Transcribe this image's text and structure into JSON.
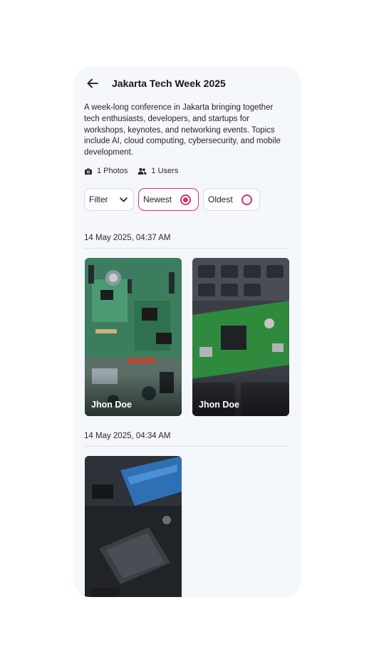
{
  "header": {
    "title": "Jakarta Tech Week 2025"
  },
  "event": {
    "description": "A week-long conference in Jakarta bringing together tech enthusiasts, developers, and startups for workshops, keynotes, and networking events. Topics include AI, cloud computing, cybersecurity, and mobile development."
  },
  "stats": {
    "photos": "1 Photos",
    "users": "1 Users"
  },
  "controls": {
    "filter_label": "Filter",
    "newest_label": "Newest",
    "oldest_label": "Oldest",
    "selected_sort": "Newest"
  },
  "groups": [
    {
      "date": "14 May 2025, 04:37 AM",
      "photos": [
        {
          "author": "Jhon Doe"
        },
        {
          "author": "Jhon Doe"
        }
      ]
    },
    {
      "date": "14 May 2025, 04:34 AM",
      "photos": [
        {
          "author": ""
        }
      ]
    }
  ],
  "colors": {
    "accent": "#d42f78",
    "background": "#f4f7fc"
  },
  "icons": {
    "back": "arrow-left-icon",
    "photos": "camera-icon",
    "users": "users-icon",
    "filter": "chevron-down-icon"
  }
}
